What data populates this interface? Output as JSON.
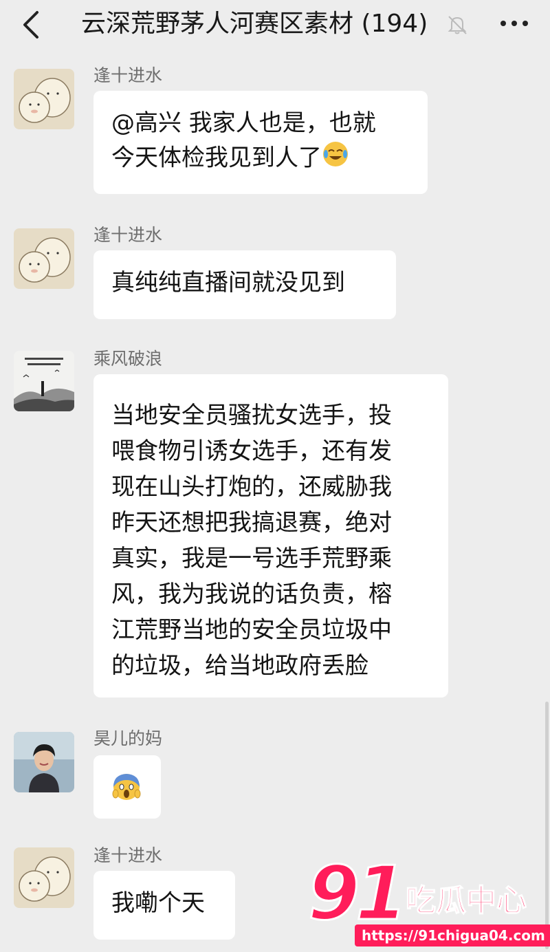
{
  "header": {
    "title": "云深荒野茅人河赛区素材 (194)",
    "back_icon": "chevron-left-icon",
    "mute_icon": "bell-muted-icon",
    "more_icon": "more-dots-icon"
  },
  "messages": [
    {
      "sender": "逢十进水",
      "lines": [
        "@高兴 我家人也是，也就",
        "今天体检我见到人了"
      ],
      "emoji": "crying-laughing-emoji"
    },
    {
      "sender": "逢十进水",
      "lines": [
        "真纯纯直播间就没见到"
      ]
    },
    {
      "sender": "乘风破浪",
      "lines": [
        "当地安全员骚扰女选手，投",
        "喂食物引诱女选手，还有发",
        "现在山头打炮的，还威胁我",
        "昨天还想把我搞退赛，绝对",
        "真实，我是一号选手荒野乘",
        "风，我为我说的话负责，榕",
        "江荒野当地的安全员垃圾中",
        "的垃圾，给当地政府丢脸"
      ]
    },
    {
      "sender": "昊儿的妈",
      "lines": [],
      "emoji": "screaming-fear-emoji"
    },
    {
      "sender": "逢十进水",
      "lines": [
        "我嘞个天"
      ]
    }
  ],
  "watermark": {
    "brand": "91",
    "name": "吃瓜中心",
    "url": "https://91chigua04.com"
  },
  "colors": {
    "bg": "#ededed",
    "bubble": "#ffffff",
    "sender": "#6e6e6e",
    "watermark": "#ff1d5a"
  }
}
